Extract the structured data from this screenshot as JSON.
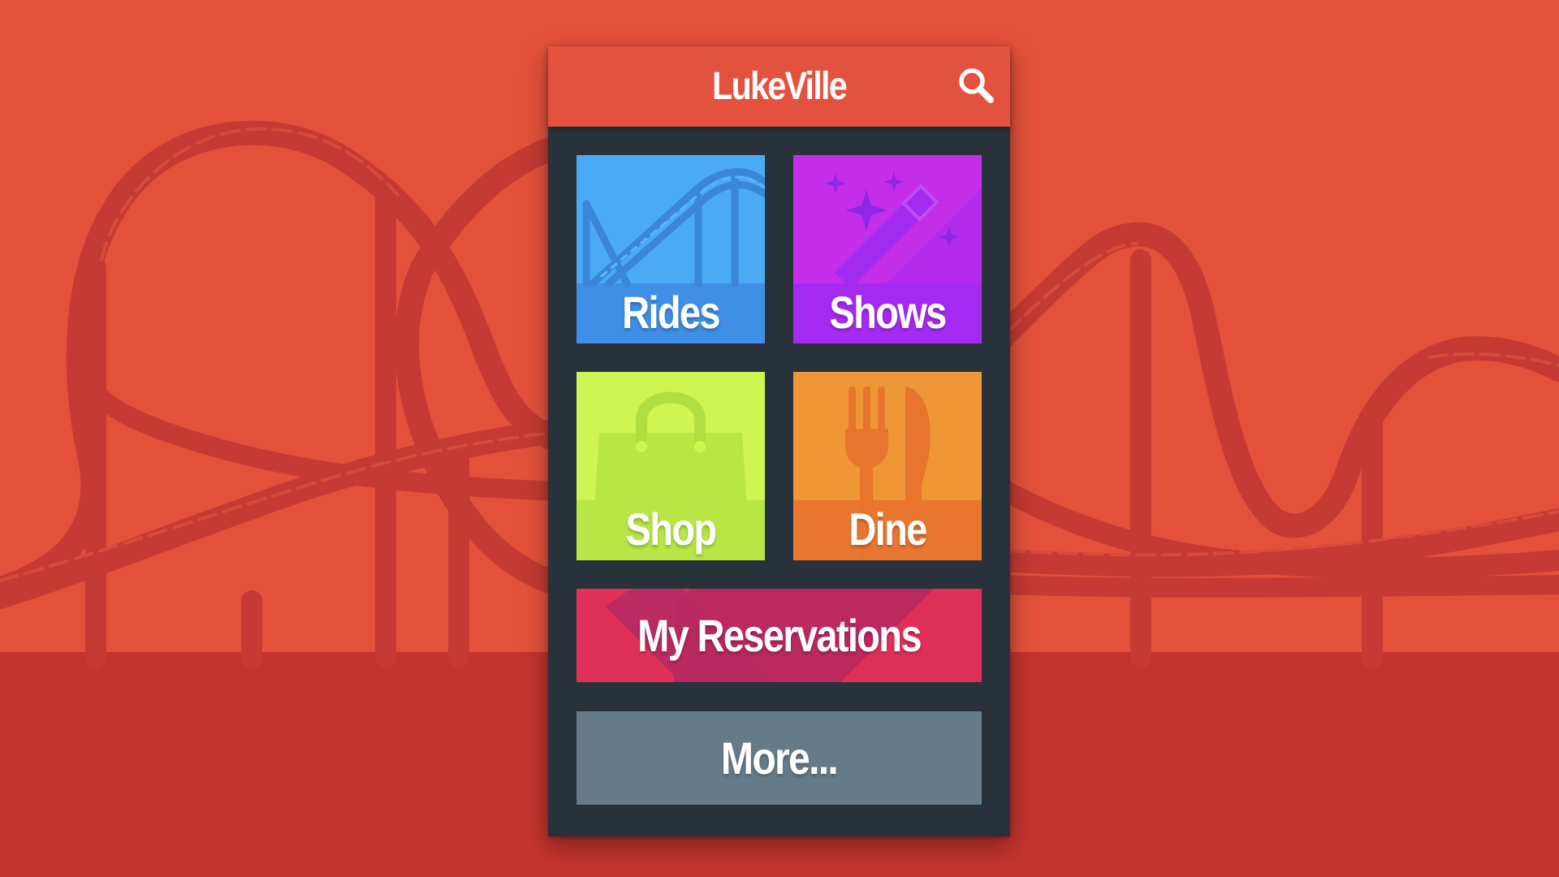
{
  "app": {
    "title": "LukeVille",
    "search_icon": "search-icon"
  },
  "tiles": [
    {
      "id": "rides",
      "label": "Rides",
      "icon": "roller-coaster-icon",
      "color": "#4aabf4",
      "band_color": "#3f8fe6"
    },
    {
      "id": "shows",
      "label": "Shows",
      "icon": "magic-wand-icon",
      "color": "#c42ee8",
      "band_color": "#a52bf2"
    },
    {
      "id": "shop",
      "label": "Shop",
      "icon": "shopping-bag-icon",
      "color": "#cff552",
      "band_color": "#b7e645"
    },
    {
      "id": "dine",
      "label": "Dine",
      "icon": "fork-knife-icon",
      "color": "#ef9636",
      "band_color": "#ea7730"
    }
  ],
  "wide_buttons": [
    {
      "id": "reservations",
      "label": "My Reservations",
      "color": "#e0305a"
    },
    {
      "id": "more",
      "label": "More...",
      "color": "#667b89"
    }
  ],
  "colors": {
    "background": "#e4513b",
    "ground": "#c4342f",
    "coaster_silhouette": "#c53a33",
    "app_bar": "#e2523f",
    "phone_body": "#29323b"
  }
}
